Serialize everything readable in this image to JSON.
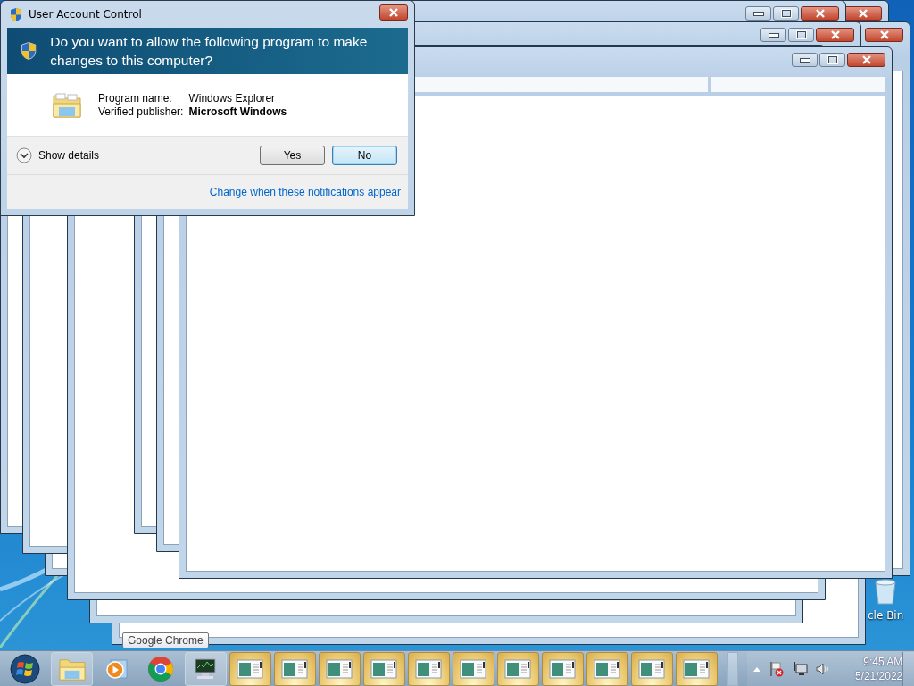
{
  "desktop": {
    "icons": [
      {
        "kind": "recycle-bin",
        "label": "cle Bin"
      }
    ]
  },
  "uac_dialog": {
    "title": "User Account Control",
    "question": "Do you want to allow the following program to make changes to this computer?",
    "details": [
      {
        "label": "Program name:",
        "value": "Windows Explorer",
        "bold": false
      },
      {
        "label": "Verified publisher:",
        "value": "Microsoft Windows",
        "bold": true
      }
    ],
    "show_details": {
      "label": "Show details",
      "expanded": false
    },
    "buttons": [
      {
        "label": "Yes",
        "default": false
      },
      {
        "label": "No",
        "default": true
      }
    ],
    "link": "Change when these notifications appear"
  },
  "tooltip": "Google Chrome",
  "taskbar": {
    "pinned": [
      {
        "kind": "explorer"
      },
      {
        "kind": "media"
      },
      {
        "kind": "chrome"
      },
      {
        "kind": "monitor"
      }
    ],
    "window_buttons": [
      {
        "kind": "window"
      },
      {
        "kind": "window"
      },
      {
        "kind": "window"
      },
      {
        "kind": "window"
      },
      {
        "kind": "window"
      },
      {
        "kind": "window"
      },
      {
        "kind": "window"
      },
      {
        "kind": "window"
      },
      {
        "kind": "window"
      },
      {
        "kind": "window"
      },
      {
        "kind": "window"
      }
    ],
    "clock": {
      "time": "9:45 AM",
      "date": "5/21/2022"
    }
  }
}
